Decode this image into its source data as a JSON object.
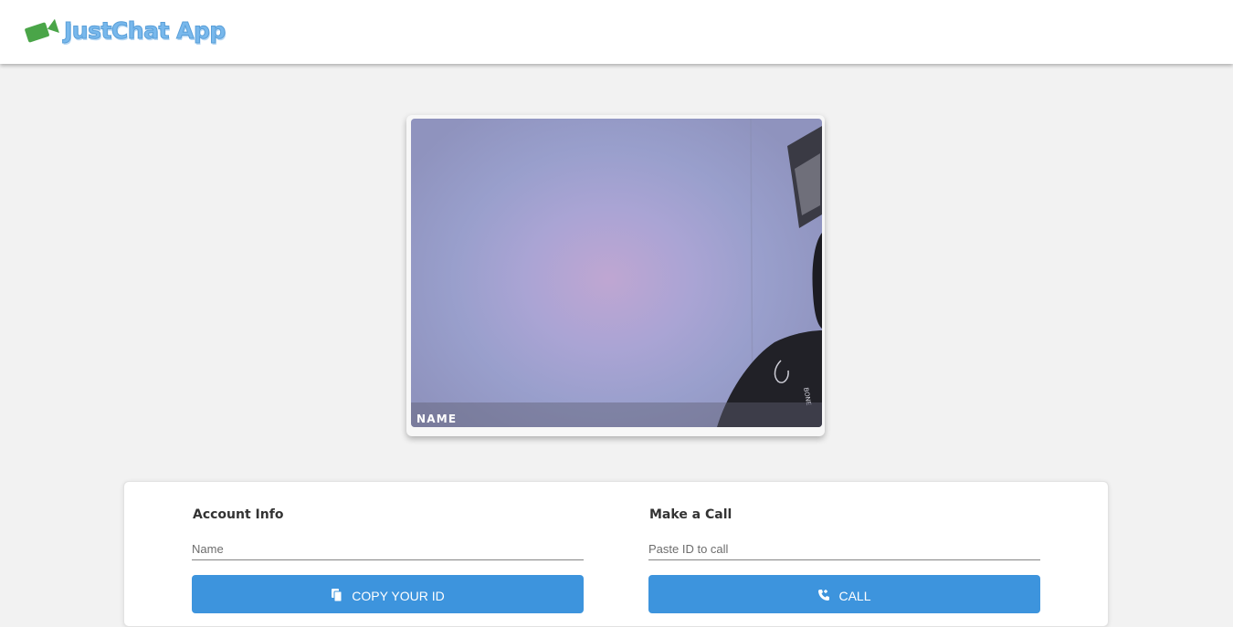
{
  "header": {
    "app_name": "JustChat App",
    "logo_icon": "video-camera-icon",
    "logo_color": "#4aa548",
    "brand_text_color": "#78b8ec"
  },
  "video": {
    "name_label": "NAME"
  },
  "account": {
    "title": "Account Info",
    "name_placeholder": "Name",
    "copy_button_label": "COPY YOUR ID",
    "copy_icon": "copy-document-icon"
  },
  "call": {
    "title": "Make a Call",
    "id_placeholder": "Paste ID to call",
    "call_button_label": "CALL",
    "call_icon": "phone-icon"
  },
  "colors": {
    "page_background": "#f2f2f2",
    "button_blue": "#3d94dd"
  }
}
